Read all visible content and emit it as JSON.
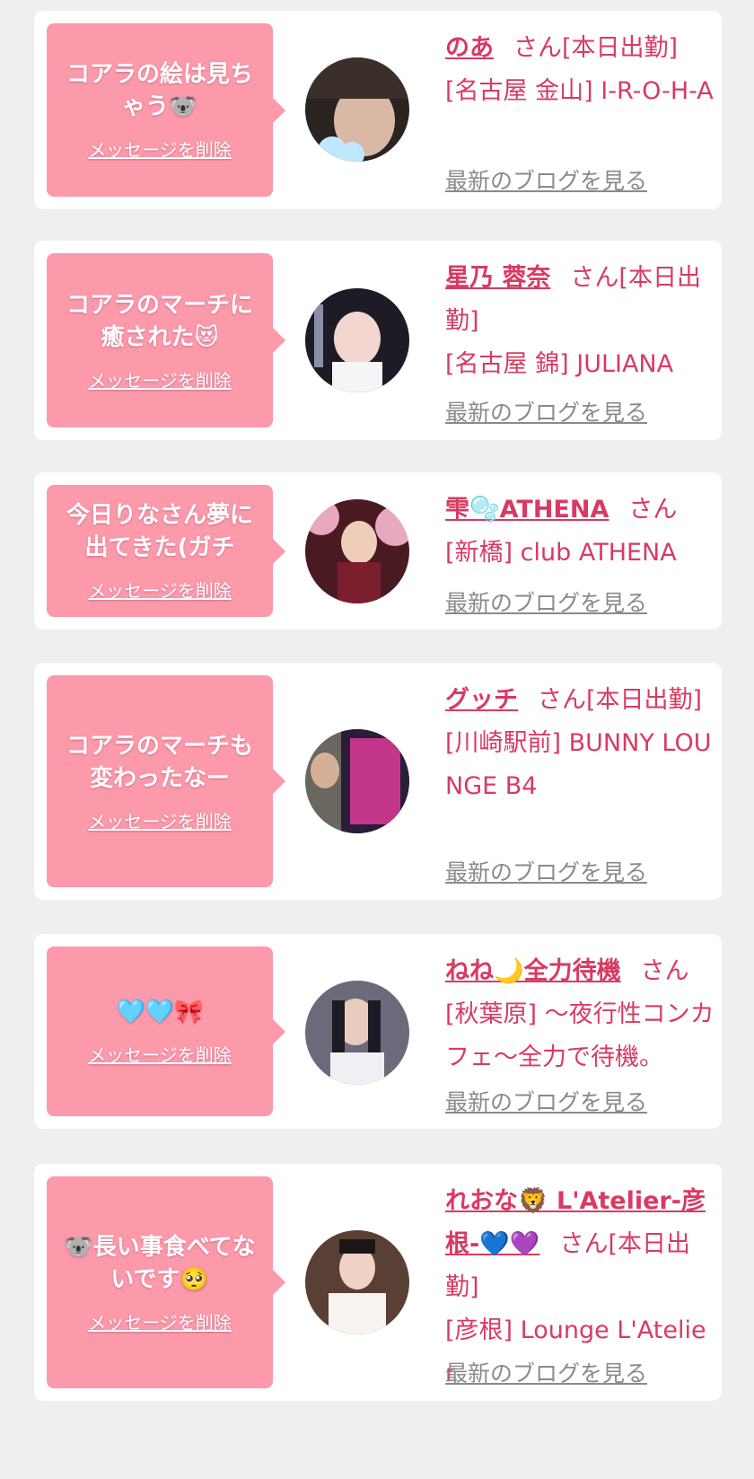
{
  "blog_link_label": "最新のブログを見る",
  "delete_label": "メッセージを削除",
  "honorific": "さん",
  "accent_color": "#d83a63",
  "bubble_color": "#fc99ab",
  "cards": [
    {
      "message": "コアラの絵は見ちゃう🐨",
      "name": "のあ",
      "status": "[本日出勤]",
      "shop": "[名古屋 金山] I-R-O-H-A"
    },
    {
      "message": "コアラのマーチに癒された😻",
      "name": "星乃 蓉奈",
      "status": "[本日出勤]",
      "shop": "[名古屋 錦] JULIANA"
    },
    {
      "message": "今日りなさん夢に出てきた(ガチ",
      "name": "雫🫧ATHENA",
      "status": "",
      "shop": "[新橋] club ATHENA"
    },
    {
      "message": "コアラのマーチも変わったなー",
      "name": "グッチ",
      "status": "[本日出勤]",
      "shop": "[川崎駅前] BUNNY LOUNGE B4"
    },
    {
      "message": "🩵🩵🎀",
      "name": "ねね🌙全力待機",
      "status": "",
      "shop": "[秋葉原] 〜夜行性コンカフェ〜全力で待機。"
    },
    {
      "message": "🐨長い事食べてないです🥺",
      "name": "れおな🦁 L'Atelier-彦根-💙💜",
      "status": "[本日出勤]",
      "shop": "[彦根] Lounge L'Atelier"
    }
  ]
}
